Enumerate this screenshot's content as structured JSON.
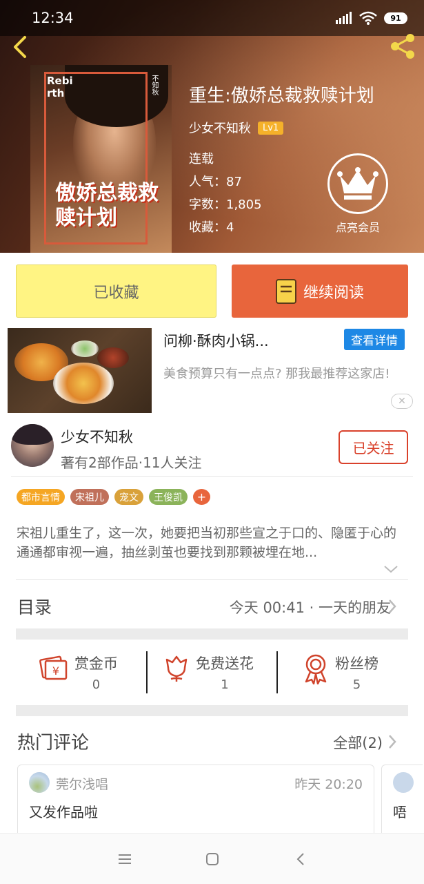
{
  "status_bar": {
    "time": "12:34",
    "battery": "91"
  },
  "book": {
    "title": "重生:傲娇总裁救赎计划",
    "author": "少女不知秋",
    "level": "Lv1",
    "status": "连载",
    "popularity": "人气：87",
    "word_count": "字数：1,805",
    "favorites": "收藏：4",
    "cover_text": {
      "rebirth": "Rebirth",
      "title": "傲娇总裁救赎计划",
      "tag": "不知秋"
    }
  },
  "vip": {
    "label": "点亮会员"
  },
  "actions": {
    "collected_label": "已收藏",
    "continue_label": "继续阅读"
  },
  "ad": {
    "title": "问柳·酥肉小锅...",
    "detail_label": "查看详情",
    "description": "美食预算只有一点点? 那我最推荐这家店!",
    "close_label": "✕"
  },
  "author_card": {
    "name": "少女不知秋",
    "stats": "著有2部作品·11人关注",
    "follow_label": "已关注"
  },
  "tags": [
    {
      "label": "都市言情",
      "color": "#f5a623"
    },
    {
      "label": "宋祖儿",
      "color": "#c0705a"
    },
    {
      "label": "宠文",
      "color": "#d9a13a"
    },
    {
      "label": "王俊凯",
      "color": "#8bb35a"
    }
  ],
  "tag_more": "+",
  "synopsis": "宋祖儿重生了，这一次，她要把当初那些宣之于口的、隐匿于心的通通都审视一遍，抽丝剥茧也要找到那颗被埋在地...",
  "toc": {
    "label": "目录",
    "latest": "今天 00:41 · 一天的朋友"
  },
  "stats": [
    {
      "label": "赏金币",
      "count": "0",
      "icon": "coin-envelope-icon"
    },
    {
      "label": "免费送花",
      "count": "1",
      "icon": "flower-icon"
    },
    {
      "label": "粉丝榜",
      "count": "5",
      "icon": "medal-icon"
    }
  ],
  "comments": {
    "label": "热门评论",
    "all_label": "全部(2)",
    "items": [
      {
        "user": "莞尔浅唱",
        "time": "昨天 20:20",
        "text": "又发作品啦"
      },
      {
        "text": "唔"
      }
    ]
  },
  "colors": {
    "accent": "#e8653c",
    "follow": "#d9412b",
    "detail_blue": "#1e88e5",
    "collect_yellow": "#fff483"
  }
}
